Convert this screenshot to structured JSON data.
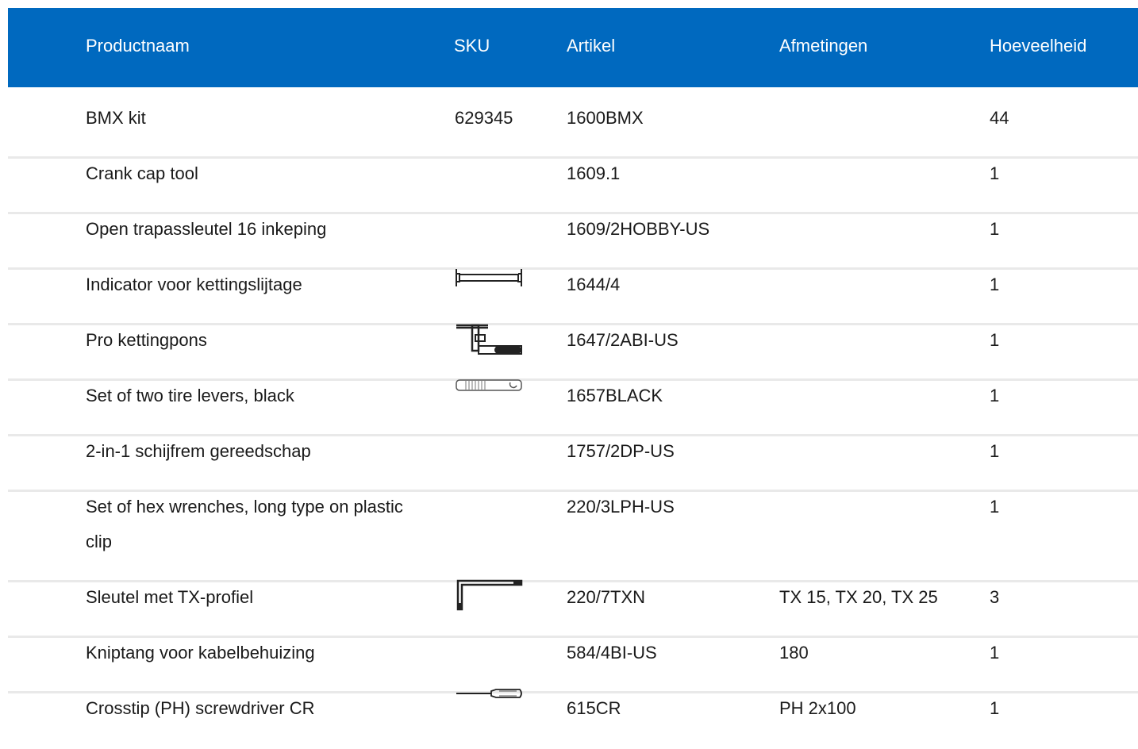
{
  "table": {
    "headers": {
      "name": "Productnaam",
      "sku": "SKU",
      "article": "Artikel",
      "dimensions": "Afmetingen",
      "quantity": "Hoeveelheid"
    },
    "rows": [
      {
        "name": "BMX kit",
        "sku": "629345",
        "article": "1600BMX",
        "dimensions": "",
        "quantity": "44",
        "icon": ""
      },
      {
        "name": "Crank cap tool",
        "sku": "",
        "article": "1609.1",
        "dimensions": "",
        "quantity": "1",
        "icon": ""
      },
      {
        "name": "Open trapassleutel 16 inkeping",
        "sku": "",
        "article": "1609/2HOBBY-US",
        "dimensions": "",
        "quantity": "1",
        "icon": ""
      },
      {
        "name": "Indicator voor kettingslijtage",
        "sku": "",
        "article": "1644/4",
        "dimensions": "",
        "quantity": "1",
        "icon": "chain-wear-indicator-icon"
      },
      {
        "name": "Pro kettingpons",
        "sku": "",
        "article": "1647/2ABI-US",
        "dimensions": "",
        "quantity": "1",
        "icon": "chain-tool-icon"
      },
      {
        "name": "Set of two tire levers, black",
        "sku": "",
        "article": "1657BLACK",
        "dimensions": "",
        "quantity": "1",
        "icon": "tire-lever-icon"
      },
      {
        "name": "2-in-1 schijfrem gereedschap",
        "sku": "",
        "article": "1757/2DP-US",
        "dimensions": "",
        "quantity": "1",
        "icon": ""
      },
      {
        "name": "Set of hex wrenches, long type on plastic clip",
        "sku": "",
        "article": "220/3LPH-US",
        "dimensions": "",
        "quantity": "1",
        "icon": ""
      },
      {
        "name": "Sleutel met TX-profiel",
        "sku": "",
        "article": "220/7TXN",
        "dimensions": "TX 15, TX 20, TX 25",
        "quantity": "3",
        "icon": "torx-key-icon"
      },
      {
        "name": "Kniptang voor kabelbehuizing",
        "sku": "",
        "article": "584/4BI-US",
        "dimensions": "180",
        "quantity": "1",
        "icon": ""
      },
      {
        "name": "Crosstip (PH) screwdriver CR",
        "sku": "",
        "article": "615CR",
        "dimensions": "PH 2x100",
        "quantity": "1",
        "icon": "screwdriver-icon"
      }
    ]
  },
  "colors": {
    "header_bg": "#0069bf",
    "header_text": "#ffffff",
    "row_divider": "#e9e9e9"
  }
}
